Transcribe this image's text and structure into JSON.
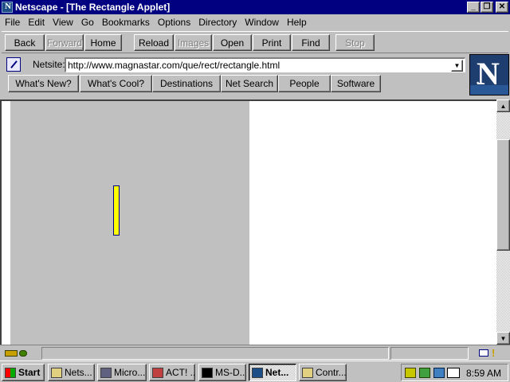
{
  "window": {
    "title": "Netscape - [The Rectangle Applet]",
    "minimize_glyph": "_",
    "restore_glyph": "❐",
    "close_glyph": "✕"
  },
  "menubar": {
    "items": [
      {
        "label": "File"
      },
      {
        "label": "Edit"
      },
      {
        "label": "View"
      },
      {
        "label": "Go"
      },
      {
        "label": "Bookmarks"
      },
      {
        "label": "Options"
      },
      {
        "label": "Directory"
      },
      {
        "label": "Window"
      },
      {
        "label": "Help"
      }
    ]
  },
  "toolbar": {
    "back": "Back",
    "forward": "Forward",
    "home": "Home",
    "reload": "Reload",
    "images": "Images",
    "open": "Open",
    "print": "Print",
    "find": "Find",
    "stop": "Stop"
  },
  "location": {
    "label": "Netsite:",
    "url": "http://www.magnastar.com/que/rect/rectangle.html",
    "dropdown_glyph": "▼"
  },
  "directory_buttons": {
    "whats_new": "What's New?",
    "whats_cool": "What's Cool?",
    "destinations": "Destinations",
    "net_search": "Net Search",
    "people": "People",
    "software": "Software"
  },
  "logo": {
    "letter": "N"
  },
  "scrollbar": {
    "up_glyph": "▲",
    "down_glyph": "▼"
  },
  "statusbar": {
    "status_text": "",
    "mail_alert": "!"
  },
  "taskbar": {
    "start": "Start",
    "tasks": [
      {
        "label": "Nets..."
      },
      {
        "label": "Micro..."
      },
      {
        "label": "ACT! ..."
      },
      {
        "label": "MS-D..."
      },
      {
        "label": "Net..."
      },
      {
        "label": "Contr..."
      }
    ],
    "clock": "8:59 AM"
  },
  "colors": {
    "titlebar": "#000080",
    "applet_background": "#c0c0c0",
    "rectangle_fill": "#ffff00",
    "rectangle_border": "#000080"
  }
}
